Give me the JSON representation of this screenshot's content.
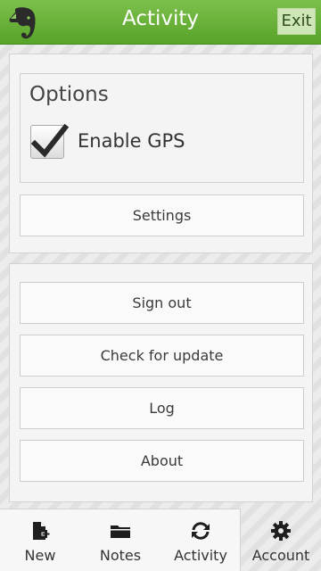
{
  "header": {
    "title": "Activity",
    "exit_label": "Exit",
    "logo_icon": "evernote-elephant-icon",
    "accent": "#6cb23a"
  },
  "options": {
    "heading": "Options",
    "gps": {
      "label": "Enable GPS",
      "checked": true
    }
  },
  "buttons": {
    "settings": "Settings",
    "sign_out": "Sign out",
    "check_update": "Check for update",
    "log": "Log",
    "about": "About"
  },
  "tabs": [
    {
      "label": "New",
      "icon": "new-note-icon",
      "active": false
    },
    {
      "label": "Notes",
      "icon": "folder-icon",
      "active": false
    },
    {
      "label": "Activity",
      "icon": "sync-icon",
      "active": false
    },
    {
      "label": "Account",
      "icon": "gear-icon",
      "active": true
    }
  ]
}
